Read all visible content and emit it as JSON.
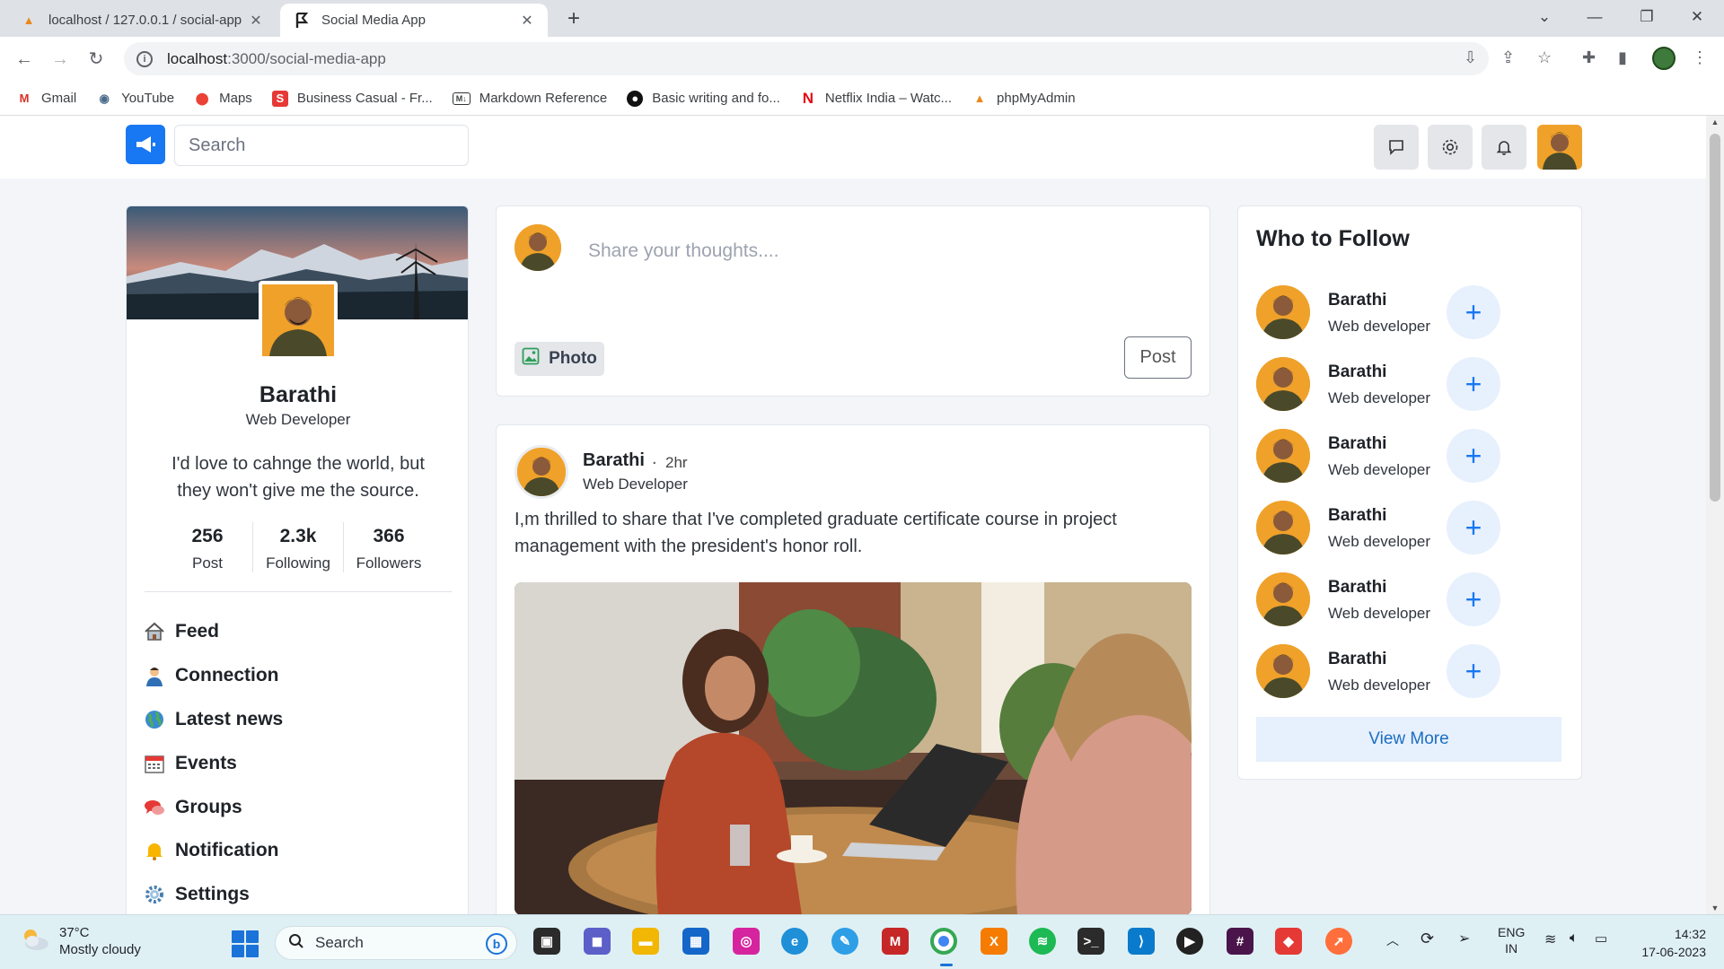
{
  "browser": {
    "tabs": [
      {
        "title": "localhost / 127.0.0.1 / social-app",
        "active": false,
        "favicon": "phpmyadmin-icon"
      },
      {
        "title": "Social Media App",
        "active": true,
        "favicon": "app-favicon"
      }
    ],
    "url_host": "localhost",
    "url_path": ":3000/social-media-app",
    "bookmarks": [
      {
        "label": "Gmail",
        "icon": "gmail-icon"
      },
      {
        "label": "YouTube",
        "icon": "youtube-icon"
      },
      {
        "label": "Maps",
        "icon": "maps-icon"
      },
      {
        "label": "Business Casual - Fr...",
        "icon": "s-icon"
      },
      {
        "label": "Markdown Reference",
        "icon": "markdown-icon"
      },
      {
        "label": "Basic writing and fo...",
        "icon": "github-icon"
      },
      {
        "label": "Netflix India – Watc...",
        "icon": "netflix-icon"
      },
      {
        "label": "phpMyAdmin",
        "icon": "phpmyadmin-icon"
      }
    ]
  },
  "header": {
    "search_placeholder": "Search"
  },
  "profile": {
    "name": "Barathi",
    "role": "Web Developer",
    "bio": "I'd love to cahnge the world, but they won't give me the source.",
    "stats": [
      {
        "value": "256",
        "label": "Post"
      },
      {
        "value": "2.3k",
        "label": "Following"
      },
      {
        "value": "366",
        "label": "Followers"
      }
    ],
    "menu": [
      {
        "label": "Feed",
        "icon": "home-icon"
      },
      {
        "label": "Connection",
        "icon": "person-icon"
      },
      {
        "label": "Latest news",
        "icon": "globe-icon"
      },
      {
        "label": "Events",
        "icon": "calendar-icon"
      },
      {
        "label": "Groups",
        "icon": "chat-bubbles-icon"
      },
      {
        "label": "Notification",
        "icon": "bell-icon"
      },
      {
        "label": "Settings",
        "icon": "gear-icon"
      }
    ]
  },
  "composer": {
    "placeholder": "Share your thoughts....",
    "photo_label": "Photo",
    "post_label": "Post"
  },
  "post": {
    "author": "Barathi",
    "separator": ".",
    "time": "2hr",
    "role": "Web Developer",
    "text": "I,m thrilled to share that I've completed graduate certificate course in project management with the president's honor roll."
  },
  "who_to_follow": {
    "title": "Who to Follow",
    "people": [
      {
        "name": "Barathi",
        "role": "Web developer"
      },
      {
        "name": "Barathi",
        "role": "Web developer"
      },
      {
        "name": "Barathi",
        "role": "Web developer"
      },
      {
        "name": "Barathi",
        "role": "Web developer"
      },
      {
        "name": "Barathi",
        "role": "Web developer"
      },
      {
        "name": "Barathi",
        "role": "Web developer"
      }
    ],
    "view_more": "View More"
  },
  "taskbar": {
    "temperature": "37°C",
    "weather": "Mostly cloudy",
    "search": "Search",
    "language": "ENG",
    "region": "IN",
    "time": "14:32",
    "date": "17-06-2023"
  },
  "colors": {
    "brand": "#1877f2",
    "page_bg": "#f3f5f9",
    "follow_button_bg": "#e7f0fd"
  }
}
